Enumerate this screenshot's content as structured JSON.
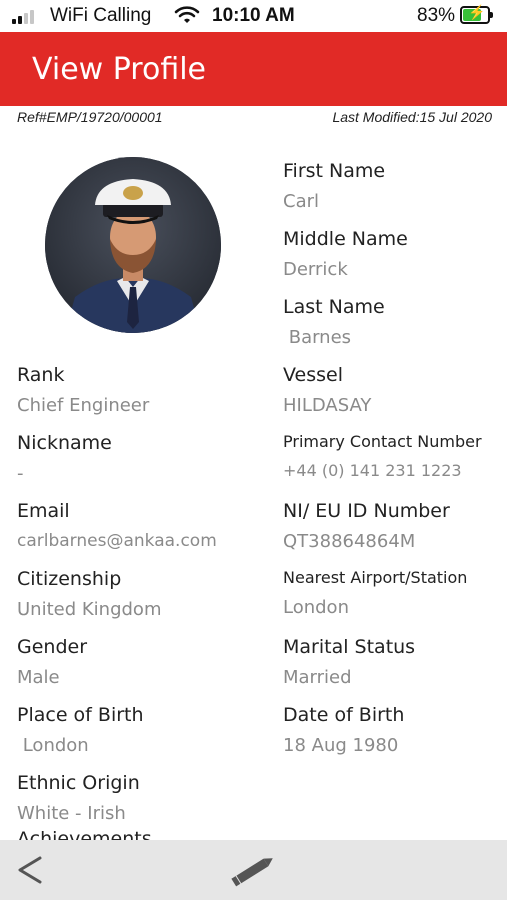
{
  "status_bar": {
    "carrier": "WiFi Calling",
    "time": "10:10 AM",
    "battery_percent": "83%",
    "battery_level": 0.83,
    "signal_bars_filled": 2,
    "signal_bars_total": 4,
    "battery_charging_color": "#38c038"
  },
  "header": {
    "title": "View Profile",
    "background_color": "#e12a26"
  },
  "meta": {
    "ref": "Ref#EMP/19720/00001",
    "last_modified": "Last Modified:15 Jul 2020"
  },
  "profile": {
    "first_name": {
      "label": "First Name",
      "value": "Carl"
    },
    "middle_name": {
      "label": "Middle Name",
      "value": "Derrick"
    },
    "last_name": {
      "label": "Last Name",
      "value": " Barnes"
    },
    "rank": {
      "label": "Rank",
      "value": "Chief Engineer"
    },
    "vessel": {
      "label": "Vessel",
      "value": "HILDASAY"
    },
    "nickname": {
      "label": "Nickname",
      "value": "-"
    },
    "primary_contact": {
      "label": "Primary Contact Number",
      "value": "+44 (0) 141 231 1223"
    },
    "email": {
      "label": "Email",
      "value": "carlbarnes@ankaa.com"
    },
    "ni_eu_id": {
      "label": "NI/ EU ID Number",
      "value": "QT38864864M"
    },
    "citizenship": {
      "label": "Citizenship",
      "value": "United Kingdom"
    },
    "nearest_airport": {
      "label": "Nearest Airport/Station",
      "value": "London"
    },
    "gender": {
      "label": "Gender",
      "value": "Male"
    },
    "marital_status": {
      "label": "Marital Status",
      "value": "Married"
    },
    "place_of_birth": {
      "label": "Place of Birth",
      "value": " London"
    },
    "date_of_birth": {
      "label": "Date of Birth",
      "value": "18 Aug 1980"
    },
    "ethnic_origin": {
      "label": "Ethnic Origin",
      "value": "White - Irish"
    },
    "achievements": {
      "label": "Achievements"
    }
  },
  "bottom_bar": {
    "back_icon": "chevron-left-icon",
    "edit_icon": "pencil-icon"
  }
}
